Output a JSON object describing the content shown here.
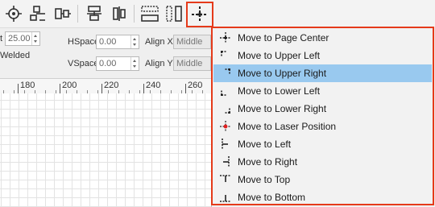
{
  "toolbar": {
    "buttons": [
      {
        "name": "align-center-target-icon"
      },
      {
        "name": "align-distribute-icon"
      },
      {
        "name": "align-horizontal-icon"
      },
      {
        "name": "align-vertical-icon"
      },
      {
        "name": "align-columns-icon"
      },
      {
        "name": "same-width-icon"
      },
      {
        "name": "same-height-icon"
      },
      {
        "name": "move-to-position-icon"
      }
    ]
  },
  "properties": {
    "size_label_fragment": "t",
    "size_value": "25.00",
    "welded_label": "Welded",
    "hspace_label": "HSpace",
    "hspace_value": "0.00",
    "vspace_label": "VSpace",
    "vspace_value": "0.00",
    "align_x_label": "Align X",
    "align_x_value": "Middle",
    "align_y_label": "Align Y",
    "align_y_value": "Middle"
  },
  "ruler": {
    "labels": [
      "180",
      "200",
      "220",
      "240",
      "260"
    ]
  },
  "menu": {
    "selected_index": 2,
    "items": [
      {
        "label": "Move to Page Center",
        "icon": "page-center-icon"
      },
      {
        "label": "Move to Upper Left",
        "icon": "upper-left-icon"
      },
      {
        "label": "Move to Upper Right",
        "icon": "upper-right-icon"
      },
      {
        "label": "Move to Lower Left",
        "icon": "lower-left-icon"
      },
      {
        "label": "Move to Lower Right",
        "icon": "lower-right-icon"
      },
      {
        "label": "Move to Laser Position",
        "icon": "laser-position-icon"
      },
      {
        "label": "Move to Left",
        "icon": "left-icon"
      },
      {
        "label": "Move to Right",
        "icon": "right-icon"
      },
      {
        "label": "Move to Top",
        "icon": "top-icon"
      },
      {
        "label": "Move to Bottom",
        "icon": "bottom-icon"
      }
    ]
  },
  "colors": {
    "highlight": "#e53a1a",
    "selection": "#99c9ef"
  }
}
